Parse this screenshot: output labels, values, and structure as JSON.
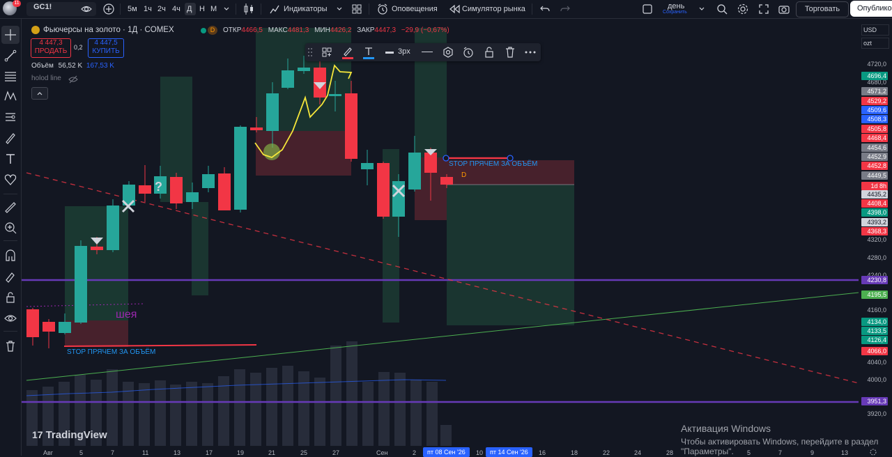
{
  "toolbar": {
    "avatar_badge": "11",
    "symbol": "GC1!",
    "intervals": [
      "5м",
      "1ч",
      "2ч",
      "4ч",
      "Д",
      "Н",
      "М"
    ],
    "indicators": "Индикаторы",
    "alerts": "Оповещения",
    "replay": "Симулятор рынка",
    "layout_name": "день",
    "layout_status": "Сохранить",
    "trade": "Торговать",
    "publish": "Опублико"
  },
  "legend": {
    "title": "Фьючерсы на золото · 1Д · COMEX",
    "open_label": "ОТКР",
    "open": "4466,5",
    "high_label": "МАКС",
    "high": "4481,3",
    "low_label": "МИН",
    "low": "4426,2",
    "close_label": "ЗАКР",
    "close": "4447,3",
    "change": "−29,9 (−0,67%)",
    "sell_price": "4 447,3",
    "sell_label": "ПРОДАТЬ",
    "spread": "0,2",
    "buy_price": "4 447,5",
    "buy_label": "КУПИТЬ",
    "volume_label": "Объём",
    "volume": "56,52 K",
    "volume_ma": "167,53 K",
    "hline_label": "holod line",
    "d_badge": "D"
  },
  "drawbar": {
    "width_label": "3px"
  },
  "annotations": {
    "neck": "шея",
    "stop_bottom": "STOP ПРЯЧЕМ ЗА ОБЪЁМ",
    "stop_top": "STOP ПРЯЧЕМ ЗА ОБЪЁМ",
    "q_mark": "?",
    "d_marker": "D"
  },
  "axis": {
    "currency": "USD",
    "unit": "ozt",
    "labels": [
      "4720,0",
      "4680,0",
      "4320,0",
      "4280,0",
      "4240,0",
      "4160,0",
      "4040,0",
      "4000,0",
      "3920,0"
    ],
    "badges": [
      {
        "text": "4696,4",
        "bg": "#089981",
        "fg": "#ffffff"
      },
      {
        "text": "4571,2",
        "bg": "#787b86",
        "fg": "#ffffff"
      },
      {
        "text": "4529,2",
        "bg": "#f23645",
        "fg": "#ffffff"
      },
      {
        "text": "4509,6",
        "bg": "#2962ff",
        "fg": "#ffffff"
      },
      {
        "text": "4508,3",
        "bg": "#2962ff",
        "fg": "#ffffff"
      },
      {
        "text": "4505,8",
        "bg": "#f23645",
        "fg": "#ffffff"
      },
      {
        "text": "4468,4",
        "bg": "#f23645",
        "fg": "#ffffff"
      },
      {
        "text": "4454,6",
        "bg": "#787b86",
        "fg": "#ffffff"
      },
      {
        "text": "4452,9",
        "bg": "#787b86",
        "fg": "#ffffff"
      },
      {
        "text": "4452,8",
        "bg": "#f23645",
        "fg": "#ffffff"
      },
      {
        "text": "4449,5",
        "bg": "#787b86",
        "fg": "#ffffff"
      },
      {
        "text": "1d 8h",
        "bg": "#f23645",
        "fg": "#ffffff"
      },
      {
        "text": "4435,2",
        "bg": "#d1d4dc",
        "fg": "#131722"
      },
      {
        "text": "4408,4",
        "bg": "#f23645",
        "fg": "#ffffff"
      },
      {
        "text": "4398,0",
        "bg": "#089981",
        "fg": "#ffffff"
      },
      {
        "text": "4393,2",
        "bg": "#d1d4dc",
        "fg": "#131722"
      },
      {
        "text": "4368,3",
        "bg": "#f23645",
        "fg": "#ffffff"
      },
      {
        "text": "4230,8",
        "bg": "#673ab7",
        "fg": "#ffffff"
      },
      {
        "text": "4195,5",
        "bg": "#4caf50",
        "fg": "#ffffff"
      },
      {
        "text": "4134,0",
        "bg": "#089981",
        "fg": "#ffffff"
      },
      {
        "text": "4133,5",
        "bg": "#089981",
        "fg": "#ffffff"
      },
      {
        "text": "4126,4",
        "bg": "#089981",
        "fg": "#ffffff"
      },
      {
        "text": "4066,0",
        "bg": "#f23645",
        "fg": "#ffffff"
      },
      {
        "text": "3951,3",
        "bg": "#673ab7",
        "fg": "#ffffff"
      }
    ]
  },
  "time_axis": {
    "labels": [
      "Авг",
      "5",
      "7",
      "11",
      "13",
      "17",
      "19",
      "21",
      "25",
      "27",
      "Сен",
      "2",
      "10",
      "16",
      "18",
      "22",
      "24",
      "28",
      "5",
      "7",
      "9",
      "13"
    ],
    "badge1": "пт 08 Сен '26",
    "badge2": "пт 14 Сен '26"
  },
  "watermark": "TradingView",
  "activation": {
    "title": "Активация Windows",
    "text": "Чтобы активировать Windows, перейдите в раздел",
    "text2": "\"Параметры\"."
  },
  "colors": {
    "up": "#26a69a",
    "down": "#f23645",
    "purple": "#673ab7",
    "green_line": "#4caf50",
    "accent": "#2962ff"
  }
}
